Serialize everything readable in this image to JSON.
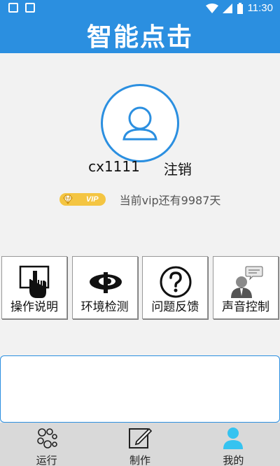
{
  "status_bar": {
    "time": "11:30",
    "battery_glyph": "⚡"
  },
  "header": {
    "title": "智能点击"
  },
  "profile": {
    "username": "cx1111",
    "logout_label": "注销",
    "vip_badge": "VIP",
    "vip_status": "当前vip还有9987天"
  },
  "tiles": [
    {
      "label": "操作说明",
      "icon": "hand-tap-icon"
    },
    {
      "label": "环境检测",
      "icon": "detect-logo-icon"
    },
    {
      "label": "问题反馈",
      "icon": "question-icon"
    },
    {
      "label": "声音控制",
      "icon": "voice-person-icon"
    }
  ],
  "bottom_nav": [
    {
      "label": "运行",
      "icon": "bubbles-icon"
    },
    {
      "label": "制作",
      "icon": "edit-icon"
    },
    {
      "label": "我的",
      "icon": "person-icon",
      "active": true
    }
  ],
  "colors": {
    "accent": "#2b8fe0",
    "vip": "#f4c542"
  }
}
